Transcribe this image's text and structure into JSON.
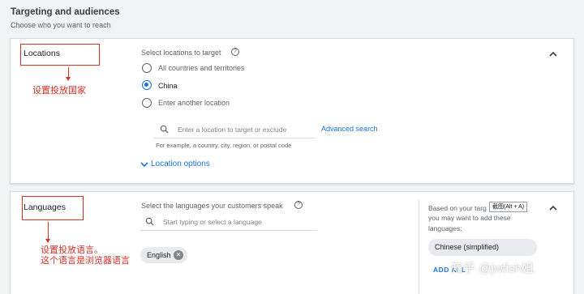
{
  "header": {
    "title": "Targeting and audiences",
    "subtitle": "Choose who you want to reach"
  },
  "locations": {
    "title": "Locations",
    "annotation": "设置投放国家",
    "select_label": "Select locations to target",
    "options": [
      {
        "label": "All countries and territories",
        "selected": false
      },
      {
        "label": "China",
        "selected": true
      },
      {
        "label": "Enter another location",
        "selected": false
      }
    ],
    "search_placeholder": "Enter a location to target or exclude",
    "advanced_search": "Advanced search",
    "hint": "For example, a country, city, region, or postal code",
    "location_options": "Location options"
  },
  "languages": {
    "title": "Languages",
    "annotation_line1": "设置投放语言。",
    "annotation_line2": "这个语言是浏览器语言",
    "select_label": "Select the languages your customers speak",
    "search_placeholder": "Start typing or select a language",
    "selected_chip": "English",
    "suggestion_line1": "Based on your targ",
    "suggestion_line2": "you may want to add these",
    "suggestion_line3": "languages:",
    "suggested_language": "Chinese (simplified)",
    "add_all": "ADD ALL",
    "tooltip": "截图(Alt + A)"
  },
  "watermark": "知乎 @jwfish姐"
}
